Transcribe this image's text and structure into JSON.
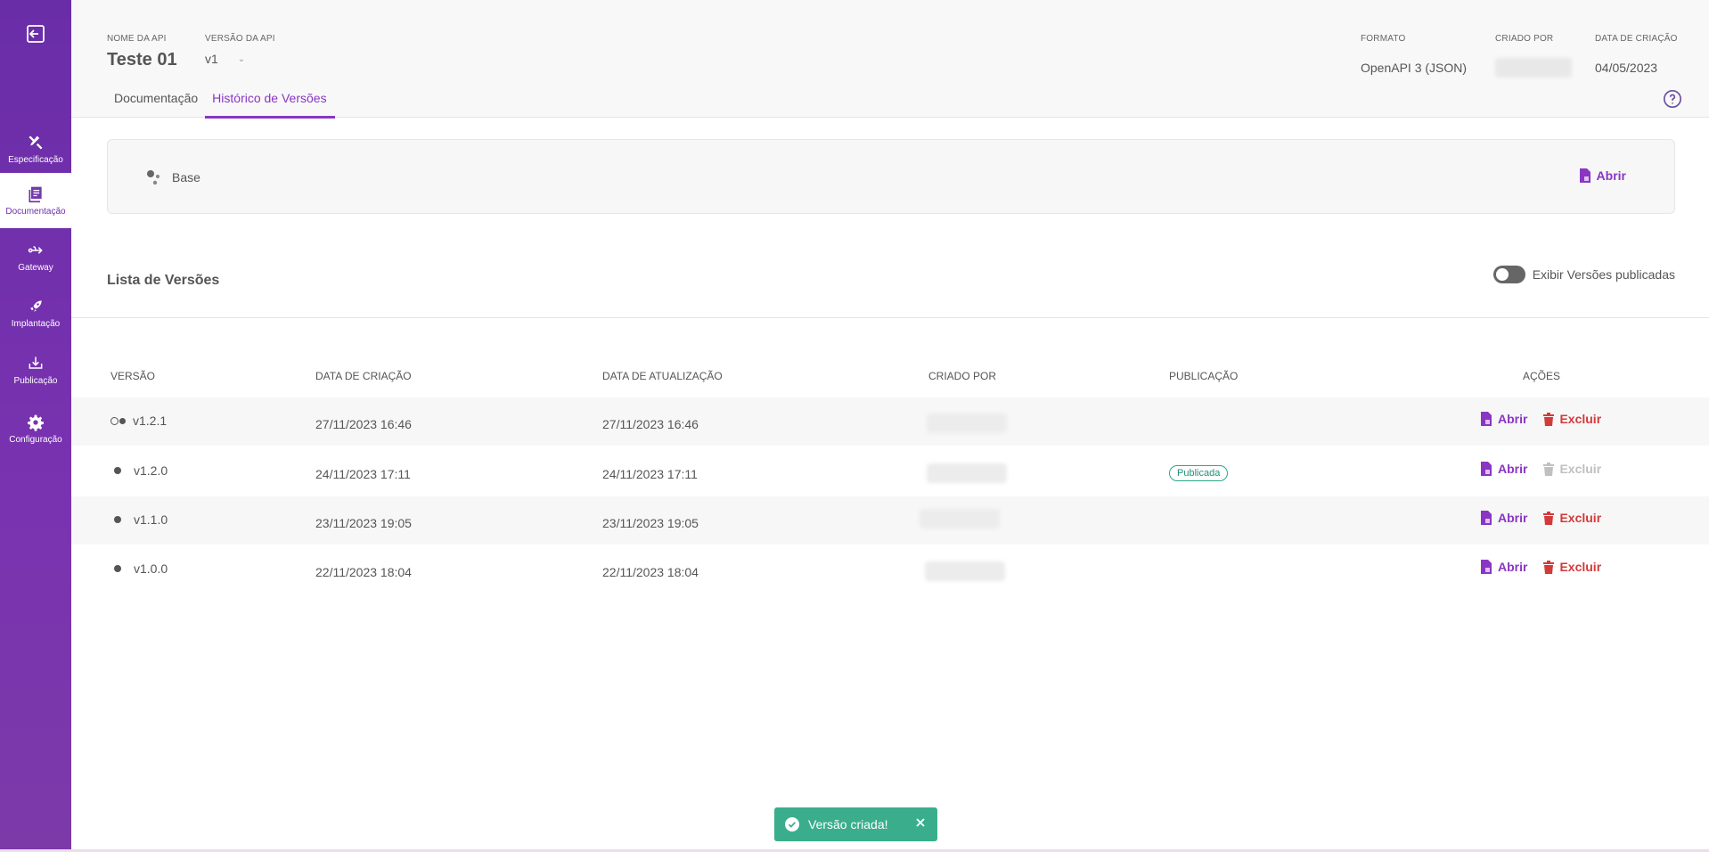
{
  "sidebar": {
    "items": [
      {
        "label": "Especificação",
        "icon": "tools-icon"
      },
      {
        "label": "Documentação",
        "icon": "book-icon",
        "active": true
      },
      {
        "label": "Gateway",
        "icon": "gateway-icon"
      },
      {
        "label": "Implantação",
        "icon": "rocket-icon"
      },
      {
        "label": "Publicação",
        "icon": "publish-icon"
      },
      {
        "label": "Configuração",
        "icon": "gear-icon"
      }
    ]
  },
  "header": {
    "api_name_label": "NOME DA API",
    "api_name": "Teste 01",
    "api_version_label": "VERSÃO DA API",
    "api_version": "v1",
    "format_label": "FORMATO",
    "format": "OpenAPI 3 (JSON)",
    "created_by_label": "CRIADO POR",
    "created_date_label": "DATA DE CRIAÇÃO",
    "created_date": "04/05/2023"
  },
  "tabs": [
    {
      "label": "Documentação",
      "active": false
    },
    {
      "label": "Histórico de Versões",
      "active": true
    }
  ],
  "base": {
    "label": "Base",
    "open_label": "Abrir"
  },
  "list": {
    "title": "Lista de Versões",
    "toggle_label": "Exibir Versões publicadas",
    "toggle_on": false,
    "columns": [
      "VERSÃO",
      "DATA DE CRIAÇÃO",
      "DATA DE ATUALIZAÇÃO",
      "CRIADO POR",
      "PUBLICAÇÃO",
      "AÇÕES"
    ],
    "rows": [
      {
        "version": "v1.2.1",
        "created": "27/11/2023 16:46",
        "updated": "27/11/2023 16:46",
        "publication": "",
        "open": "Abrir",
        "delete": "Excluir",
        "delete_enabled": true
      },
      {
        "version": "v1.2.0",
        "created": "24/11/2023 17:11",
        "updated": "24/11/2023 17:11",
        "publication": "Publicada",
        "open": "Abrir",
        "delete": "Excluir",
        "delete_enabled": false
      },
      {
        "version": "v1.1.0",
        "created": "23/11/2023 19:05",
        "updated": "23/11/2023 19:05",
        "publication": "",
        "open": "Abrir",
        "delete": "Excluir",
        "delete_enabled": true
      },
      {
        "version": "v1.0.0",
        "created": "22/11/2023 18:04",
        "updated": "22/11/2023 18:04",
        "publication": "",
        "open": "Abrir",
        "delete": "Excluir",
        "delete_enabled": true
      }
    ]
  },
  "toast": {
    "message": "Versão criada!"
  },
  "colors": {
    "sidebar": "#6a2da8",
    "accent": "#8a35c4",
    "danger": "#d33a3a",
    "success": "#3aae8c"
  }
}
